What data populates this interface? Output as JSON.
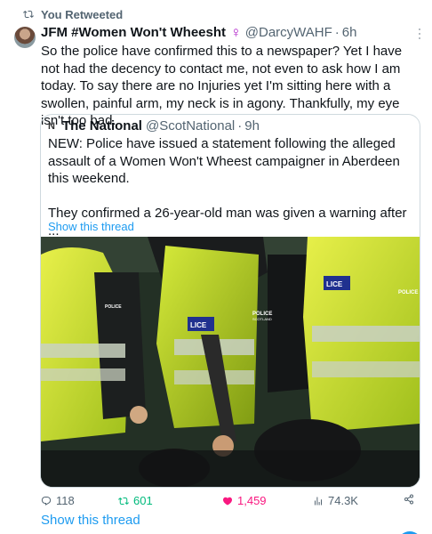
{
  "retweet_banner": {
    "label": "You Retweeted",
    "icon": "retweet-icon"
  },
  "tweet": {
    "author_name": "JFM #Women Won't Wheesht",
    "venus_symbol": "♀",
    "handle": "@DarcyWAHF",
    "separator": "·",
    "time": "6h",
    "text": "So the police have confirmed this to a newspaper? Yet I have not had the decency to contact me, not even to ask how I am today. To say there are no Injuries yet  I'm sitting here with a swollen, painful arm, my neck is in agony. Thankfully, my eye isn't too bad."
  },
  "quote": {
    "author_name": "The National",
    "handle": "@ScotNational",
    "separator": "·",
    "time": "9h",
    "paragraph_1": "NEW: Police have issued a statement following the alleged assault of a Women Won't Wheest campaigner in Aberdeen this weekend.",
    "paragraph_2": "They confirmed a 26-year-old man was given a warning after ...",
    "show_thread": "Show this thread",
    "photo_text": {
      "badge_a": "POLICE",
      "badge_b": "POLICE",
      "badge_c": "POLICE",
      "badge_sub": "SCOTLAND",
      "vest_a": "LICE",
      "vest_b": "LICE"
    }
  },
  "actions": {
    "replies": "118",
    "retweets": "601",
    "likes": "1,459",
    "views": "74.3K"
  },
  "footer": {
    "show_thread": "Show this thread"
  },
  "colors": {
    "accent": "#1d9bf0",
    "retweet": "#00ba7c",
    "like": "#f91880",
    "venus": "#b022c9",
    "muted": "#536471"
  }
}
